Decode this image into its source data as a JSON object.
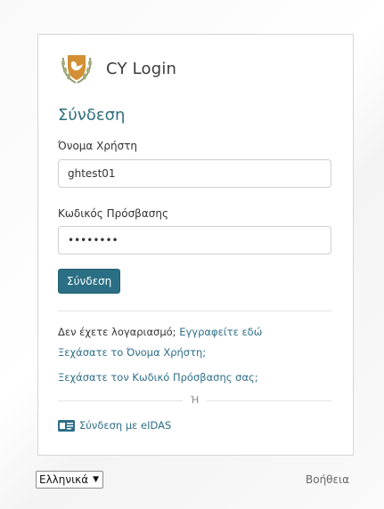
{
  "brand": {
    "name": "CY Login",
    "emblem_icon": "cyprus-emblem-icon"
  },
  "login": {
    "title": "Σύνδεση",
    "username_label": "Όνομα Χρήστη",
    "username_value": "ghtest01",
    "password_label": "Κωδικός Πρόσβασης",
    "password_value": "••••••••",
    "submit_label": "Σύνδεση"
  },
  "links": {
    "no_account_text": "Δεν έχετε λογαριασμό;",
    "register_link": "Εγγραφείτε εδώ",
    "forgot_username": "Ξεχάσατε το Όνομα Χρήστη;",
    "forgot_password": "Ξεχάσατε τον Κωδικό Πρόσβασης σας;"
  },
  "separator": {
    "or_text": "Ή"
  },
  "eidas": {
    "icon": "id-card-icon",
    "label": "Σύνδεση με eIDAS"
  },
  "footer": {
    "language_selected": "Ελληνικά",
    "help_label": "Βοήθεια"
  },
  "colors": {
    "primary": "#2a6f83",
    "title": "#2e6e7c",
    "link": "#2e6e88",
    "emblem_gold": "#c98a2e"
  }
}
